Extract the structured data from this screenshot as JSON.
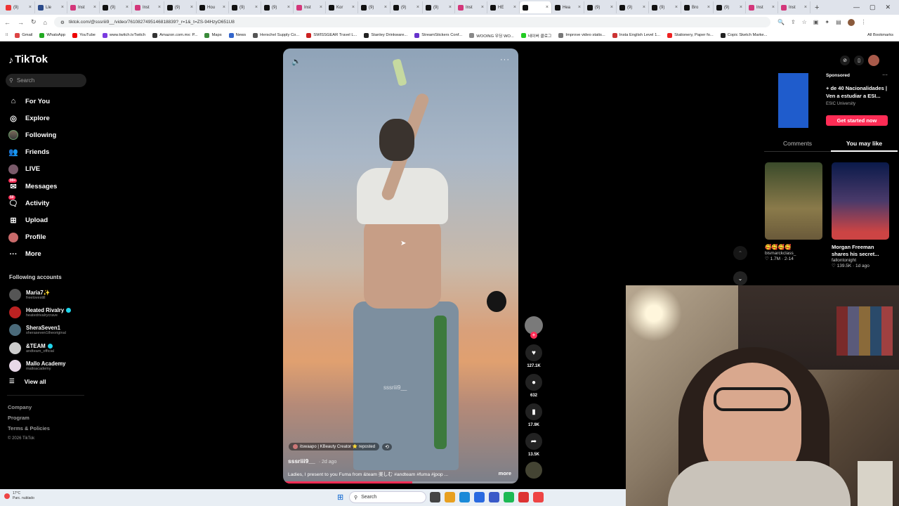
{
  "browser": {
    "tabs": [
      {
        "title": "(9)",
        "color": "#e33"
      },
      {
        "title": "Lle",
        "color": "#2a4a8a"
      },
      {
        "title": "Inst",
        "color": "#d3367a"
      },
      {
        "title": "(9)",
        "color": "#111"
      },
      {
        "title": "Inst",
        "color": "#d3367a"
      },
      {
        "title": "(9)",
        "color": "#111"
      },
      {
        "title": "Hou",
        "color": "#111"
      },
      {
        "title": "(9)",
        "color": "#111"
      },
      {
        "title": "(9)",
        "color": "#111"
      },
      {
        "title": "Inst",
        "color": "#d3367a"
      },
      {
        "title": "Kor",
        "color": "#111"
      },
      {
        "title": "(9)",
        "color": "#111"
      },
      {
        "title": "(9)",
        "color": "#111"
      },
      {
        "title": "(9)",
        "color": "#111"
      },
      {
        "title": "Inst",
        "color": "#d3367a"
      },
      {
        "title": "HE",
        "color": "#111"
      },
      {
        "title": "",
        "color": "#111",
        "active": true
      },
      {
        "title": "Hea",
        "color": "#111"
      },
      {
        "title": "(9)",
        "color": "#111"
      },
      {
        "title": "(9)",
        "color": "#111"
      },
      {
        "title": "(9)",
        "color": "#111"
      },
      {
        "title": "Bro",
        "color": "#111"
      },
      {
        "title": "(9)",
        "color": "#111"
      },
      {
        "title": "Inst",
        "color": "#d3367a"
      },
      {
        "title": "Inst",
        "color": "#d3367a"
      }
    ],
    "url": "tiktok.com/@sssriii9__/video/7610827495146818839?_r=1&_t=ZS-94HzyO651U8",
    "bookmarks": [
      {
        "label": "Gmail",
        "color": "#d44"
      },
      {
        "label": "WhatsApp",
        "color": "#2a2"
      },
      {
        "label": "YouTube",
        "color": "#e00"
      },
      {
        "label": "www.twitch.tvTwitch",
        "color": "#7a3ae0"
      },
      {
        "label": "Amazon.com.mx: P...",
        "color": "#333"
      },
      {
        "label": "Maps",
        "color": "#3a8a3a"
      },
      {
        "label": "News",
        "color": "#36c"
      },
      {
        "label": "Herschel Supply Co...",
        "color": "#555"
      },
      {
        "label": "SWISSGEAR Travel L...",
        "color": "#c22"
      },
      {
        "label": "Stanley Drinkware...",
        "color": "#222"
      },
      {
        "label": "StreamStickers Conf...",
        "color": "#63c"
      },
      {
        "label": "WOOING 우딩 WO...",
        "color": "#888"
      },
      {
        "label": "네이버 클로그",
        "color": "#2c2"
      },
      {
        "label": "Improve video statis...",
        "color": "#777"
      },
      {
        "label": "Insta English Level 1...",
        "color": "#c33"
      },
      {
        "label": "Stationery, Paper fo...",
        "color": "#e22"
      },
      {
        "label": "Copic Sketch Marke...",
        "color": "#222"
      }
    ],
    "all_bookmarks": "All Bookmarks"
  },
  "sidebar": {
    "logo": "TikTok",
    "search_placeholder": "Search",
    "nav": [
      {
        "label": "For You",
        "icon": "home-icon",
        "glyph": "⌂"
      },
      {
        "label": "Explore",
        "icon": "compass-icon",
        "glyph": "◎"
      },
      {
        "label": "Following",
        "icon": "following-avatar-icon",
        "glyph": ""
      },
      {
        "label": "Friends",
        "icon": "friends-icon",
        "glyph": "👥"
      },
      {
        "label": "LIVE",
        "icon": "live-avatar-icon",
        "glyph": ""
      },
      {
        "label": "Messages",
        "icon": "messages-icon",
        "glyph": "✉",
        "badge": "99+"
      },
      {
        "label": "Activity",
        "icon": "activity-icon",
        "glyph": "🗨",
        "badge": "50"
      },
      {
        "label": "Upload",
        "icon": "upload-icon",
        "glyph": "⊞"
      },
      {
        "label": "Profile",
        "icon": "profile-avatar-icon",
        "glyph": ""
      },
      {
        "label": "More",
        "icon": "more-icon",
        "glyph": "···"
      }
    ],
    "following_title": "Following accounts",
    "following": [
      {
        "name": "Maria7✨",
        "handle": "freelovestill",
        "color": "#555",
        "verified": false
      },
      {
        "name": "Heated Rivalry",
        "handle": "heatedrivalrycrave",
        "color": "#b22",
        "verified": true
      },
      {
        "name": "SheraSeven1",
        "handle": "sheraseven1theoriginal",
        "color": "#4a6a7a",
        "verified": false
      },
      {
        "name": "&TEAM",
        "handle": "andteam_official",
        "color": "#ccc",
        "verified": true
      },
      {
        "name": "Mallo Academy",
        "handle": "malloacademy",
        "color": "#e8d8e8",
        "verified": false
      }
    ],
    "view_all": "View all",
    "footer": {
      "company": "Company",
      "program": "Program",
      "terms": "Terms & Policies",
      "copyright": "© 2026 TikTok"
    }
  },
  "video": {
    "watermark": "sssriii9__",
    "repost_by": "itswaapo | KBeauty Creator ⭐ reposted",
    "author": "sssriii9__",
    "date": "· 2d ago",
    "caption": "Ladies, I present to you Fuma from &team 楽しむ #andteam #fuma #jpop ...",
    "more": "more",
    "progress": 0.55
  },
  "actions": {
    "likes": "127.1K",
    "comments": "632",
    "saves": "17.9K",
    "shares": "13.5K"
  },
  "right_panel": {
    "ad": {
      "sponsored": "Sponsored",
      "title": "+ de 40 Nacionalidades | Ven a estudiar a ESI...",
      "brand": "ESIC University",
      "cta": "Get started now"
    },
    "tabs": [
      "Comments",
      "You may like"
    ],
    "recs": [
      {
        "caption": "🥰🥰🥰🥰",
        "author": "bismarckclass_",
        "stats": "♡ 1.7M · 2-14"
      },
      {
        "caption": "Morgan Freeman shares his secret...",
        "author": "fallontonight",
        "stats": "♡ 139.5K · 1d ago"
      }
    ]
  },
  "taskbar": {
    "temp": "17°C",
    "weather": "Parc. nublado",
    "search": "Search"
  }
}
